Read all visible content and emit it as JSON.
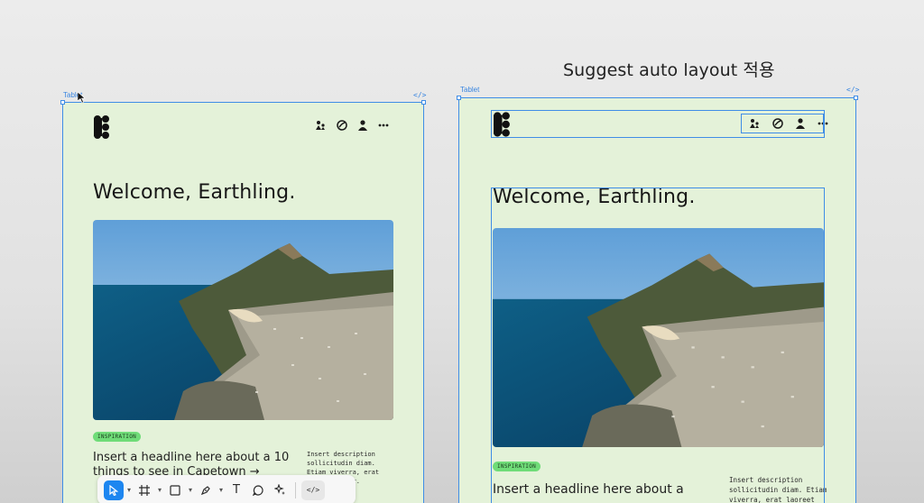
{
  "caption": "Suggest auto layout 적용",
  "frames": {
    "left_label": "Tablet",
    "right_label": "Tablet",
    "code_glyph": "</>"
  },
  "site": {
    "welcome": "Welcome, Earthling.",
    "nav_icons": [
      "people-icon",
      "globe-icon",
      "user-icon",
      "more-icon"
    ],
    "tag": "INSPIRATION",
    "headline_left": "Insert a headline here about a 10 things to see in Capetown →",
    "headline_right": "Insert a headline here about a",
    "description": "Insert description sollicitudin diam. Etiam viverra, erat laoreet lobor."
  },
  "toolbar": {
    "tools": [
      "move-tool",
      "frame-tool",
      "shape-tool",
      "pen-tool",
      "text-tool",
      "comment-tool",
      "actions-tool"
    ],
    "text_tool_glyph": "T",
    "code_label": "</>"
  },
  "colors": {
    "frame_bg": "#e4f2d9",
    "selection": "#3f8de6",
    "tag_green": "#6fdc78",
    "active_tool": "#1d86f0"
  }
}
